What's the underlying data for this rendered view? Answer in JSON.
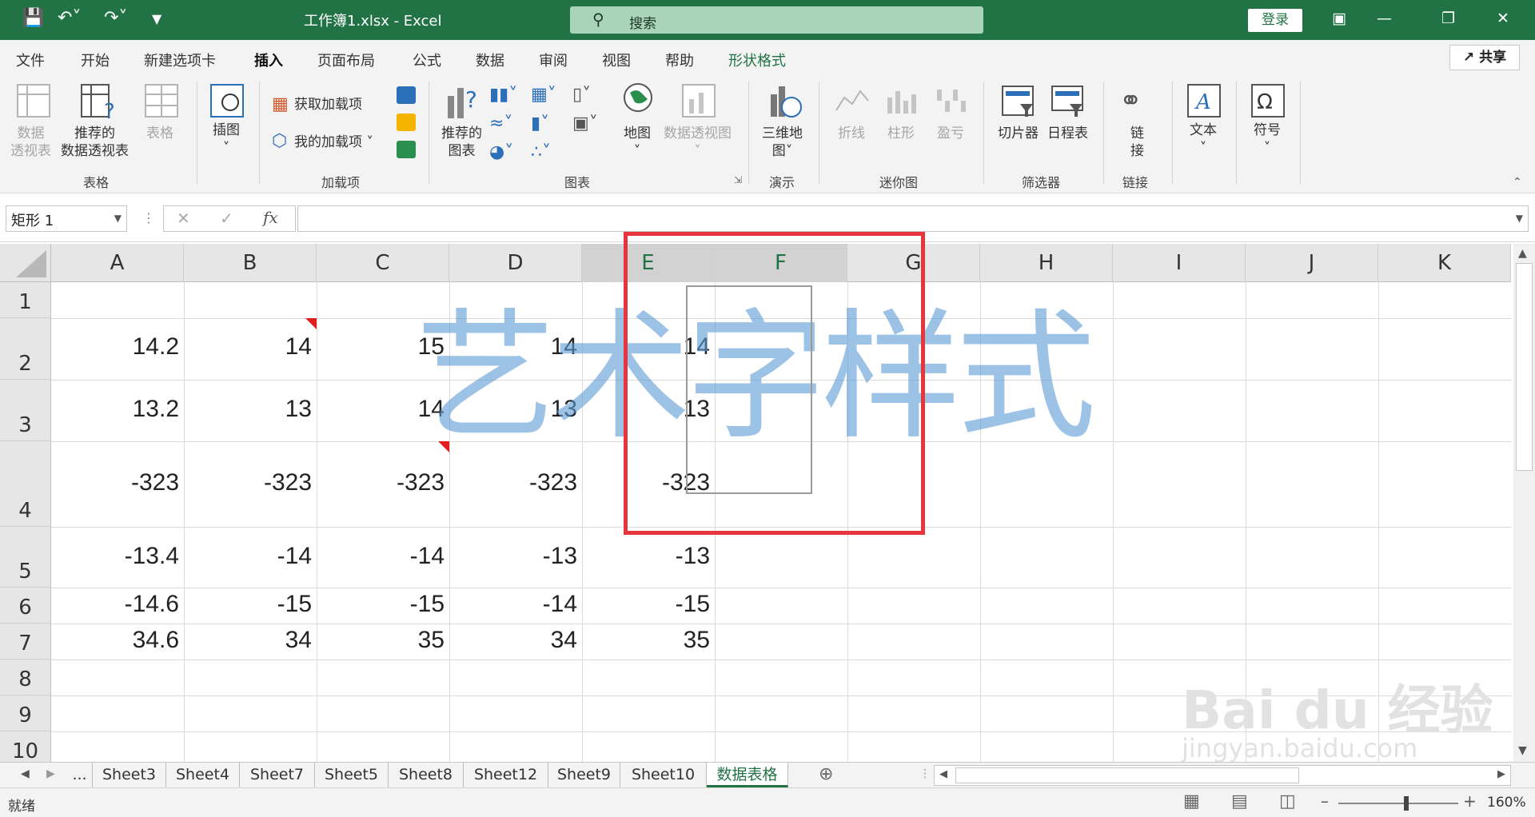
{
  "titlebar": {
    "title": "工作簿1.xlsx  -  Excel",
    "search_placeholder": "搜索",
    "login": "登录"
  },
  "tabs": [
    "文件",
    "开始",
    "新建选项卡",
    "插入",
    "页面布局",
    "公式",
    "数据",
    "审阅",
    "视图",
    "帮助",
    "形状格式"
  ],
  "active_tab": "插入",
  "share": "共享",
  "ribbon": {
    "table_group": {
      "pivot": [
        "数据",
        "透视表"
      ],
      "recommended_pivot": [
        "推荐的",
        "数据透视表"
      ],
      "table": "表格",
      "label": "表格"
    },
    "illustrations": {
      "label": "插图"
    },
    "addins": {
      "get": "获取加载项",
      "mine": "我的加载项",
      "label": "加载项"
    },
    "charts": {
      "recommended": [
        "推荐的",
        "图表"
      ],
      "map": "地图",
      "pivot_chart": "数据透视图",
      "label": "图表"
    },
    "tours": {
      "map3d": [
        "三维地",
        "图"
      ],
      "label": "演示"
    },
    "sparklines": {
      "line": "折线",
      "column": "柱形",
      "winloss": "盈亏",
      "label": "迷你图"
    },
    "filters": {
      "slicer": "切片器",
      "timeline": "日程表",
      "label": "筛选器"
    },
    "links": {
      "link": [
        "链",
        "接"
      ],
      "label": "链接"
    },
    "text": {
      "label": "文本"
    },
    "symbols": {
      "label": "符号"
    }
  },
  "formula_bar": {
    "name_box": "矩形 1",
    "fx": "fx",
    "content": ""
  },
  "columns": [
    "A",
    "B",
    "C",
    "D",
    "E",
    "F",
    "G",
    "H",
    "I",
    "J",
    "K"
  ],
  "rows": [
    "1",
    "2",
    "3",
    "4",
    "5",
    "6",
    "7",
    "8",
    "9",
    "10"
  ],
  "cells": [
    [
      "",
      "",
      "",
      "",
      ""
    ],
    [
      "14.2",
      "14",
      "15",
      "14",
      "14"
    ],
    [
      "13.2",
      "13",
      "14",
      "13",
      "13"
    ],
    [
      "-323",
      "-323",
      "-323",
      "-323",
      "-323"
    ],
    [
      "-13.4",
      "-14",
      "-14",
      "-13",
      "-13"
    ],
    [
      "-14.6",
      "-15",
      "-15",
      "-14",
      "-15"
    ],
    [
      "34.6",
      "34",
      "35",
      "34",
      "35"
    ]
  ],
  "wordart_text": "艺术字样式",
  "sheets": [
    "...",
    "Sheet3",
    "Sheet4",
    "Sheet7",
    "Sheet5",
    "Sheet8",
    "Sheet12",
    "Sheet9",
    "Sheet10",
    "数据表格"
  ],
  "active_sheet": "数据表格",
  "status": {
    "ready": "就绪",
    "zoom": "160%"
  },
  "watermark": {
    "brand": "Bai du 经验",
    "url": "jingyan.baidu.com"
  },
  "colors": {
    "excel_green": "#217346",
    "wordart_blue": "#5b9bd5",
    "annotation_red": "#e8353b"
  }
}
